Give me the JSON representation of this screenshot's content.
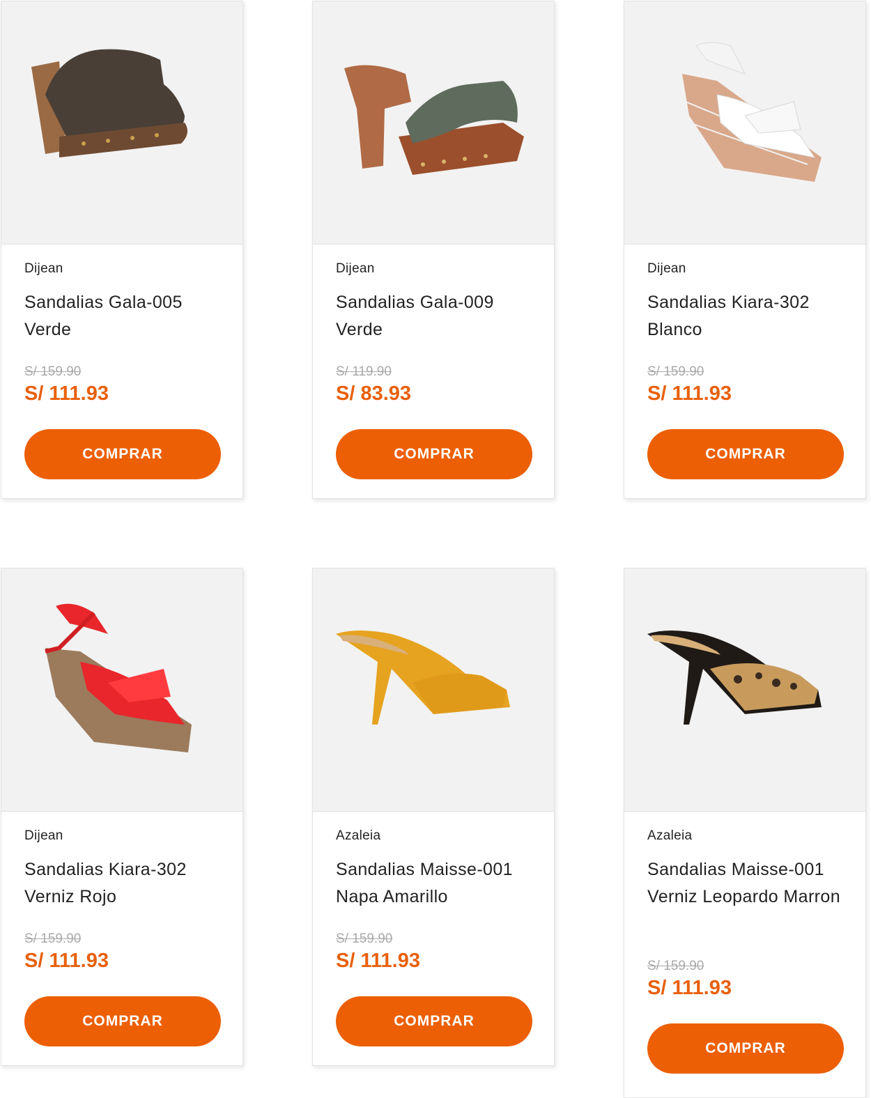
{
  "products": [
    {
      "brand": "Dijean",
      "name": "Sandalias Gala-005 Verde",
      "old_price": "S/ 159.90",
      "price": "S/ 111.93",
      "button": "COMPRAR",
      "image": "brown-clog-icon"
    },
    {
      "brand": "Dijean",
      "name": "Sandalias Gala-009 Verde",
      "old_price": "S/ 119.90",
      "price": "S/ 83.93",
      "button": "COMPRAR",
      "image": "green-mule-icon"
    },
    {
      "brand": "Dijean",
      "name": "Sandalias Kiara-302 Blanco",
      "old_price": "S/ 159.90",
      "price": "S/ 111.93",
      "button": "COMPRAR",
      "image": "white-wedge-icon"
    },
    {
      "brand": "Dijean",
      "name": "Sandalias Kiara-302 Verniz Rojo",
      "old_price": "S/ 159.90",
      "price": "S/ 111.93",
      "button": "COMPRAR",
      "image": "red-wedge-icon"
    },
    {
      "brand": "Azaleia",
      "name": "Sandalias Maisse-001 Napa Amarillo",
      "old_price": "S/ 159.90",
      "price": "S/ 111.93",
      "button": "COMPRAR",
      "image": "yellow-heel-icon"
    },
    {
      "brand": "Azaleia",
      "name": "Sandalias Maisse-001 Verniz Leopardo Marron",
      "old_price": "S/ 159.90",
      "price": "S/ 111.93",
      "button": "COMPRAR",
      "image": "leopard-heel-icon"
    }
  ],
  "colors": {
    "accent": "#ec5f05",
    "price": "#e8600b",
    "old_price": "#a9a9a9"
  }
}
